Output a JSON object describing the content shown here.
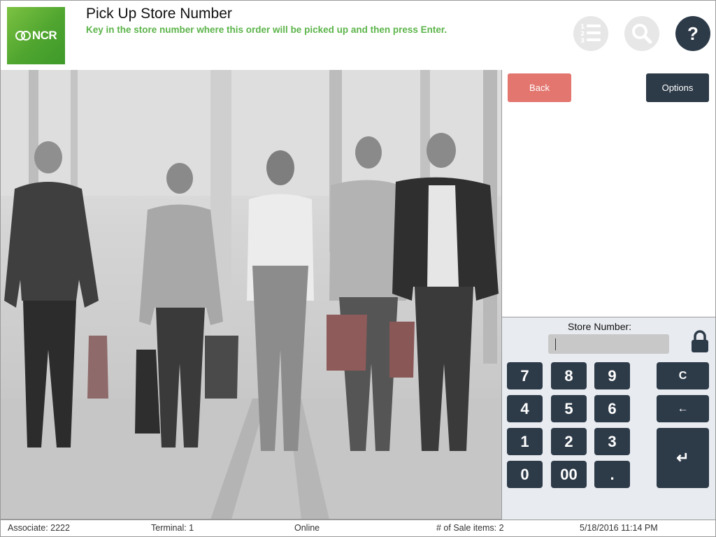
{
  "header": {
    "logo_text": "NCR",
    "title": "Pick Up Store Number",
    "subtitle": "Key in the store number where this order will be picked up and then press Enter.",
    "icons": [
      "list-numbered-icon",
      "search-icon",
      "help-icon"
    ],
    "help_label": "?"
  },
  "photo": {
    "icon": "shoppers-photo"
  },
  "panel": {
    "back_label": "Back",
    "options_label": "Options"
  },
  "keypad": {
    "field_label": "Store Number:",
    "field_value": "",
    "keys": {
      "k7": "7",
      "k8": "8",
      "k9": "9",
      "k4": "4",
      "k5": "5",
      "k6": "6",
      "k1": "1",
      "k2": "2",
      "k3": "3",
      "k0": "0",
      "k00": "00",
      "kdot": ".",
      "clear": "C",
      "backspace": "←",
      "enter": "↵"
    }
  },
  "status": {
    "associate": "Associate: 2222",
    "terminal": "Terminal: 1",
    "connection": "Online",
    "sale_items": "# of Sale items: 2",
    "datetime": "5/18/2016 11:14 PM"
  },
  "colors": {
    "accent_green": "#5cb44a",
    "dark_navy": "#2d3a48",
    "back_red": "#e37770",
    "keypad_bg": "#e8ebf0"
  }
}
